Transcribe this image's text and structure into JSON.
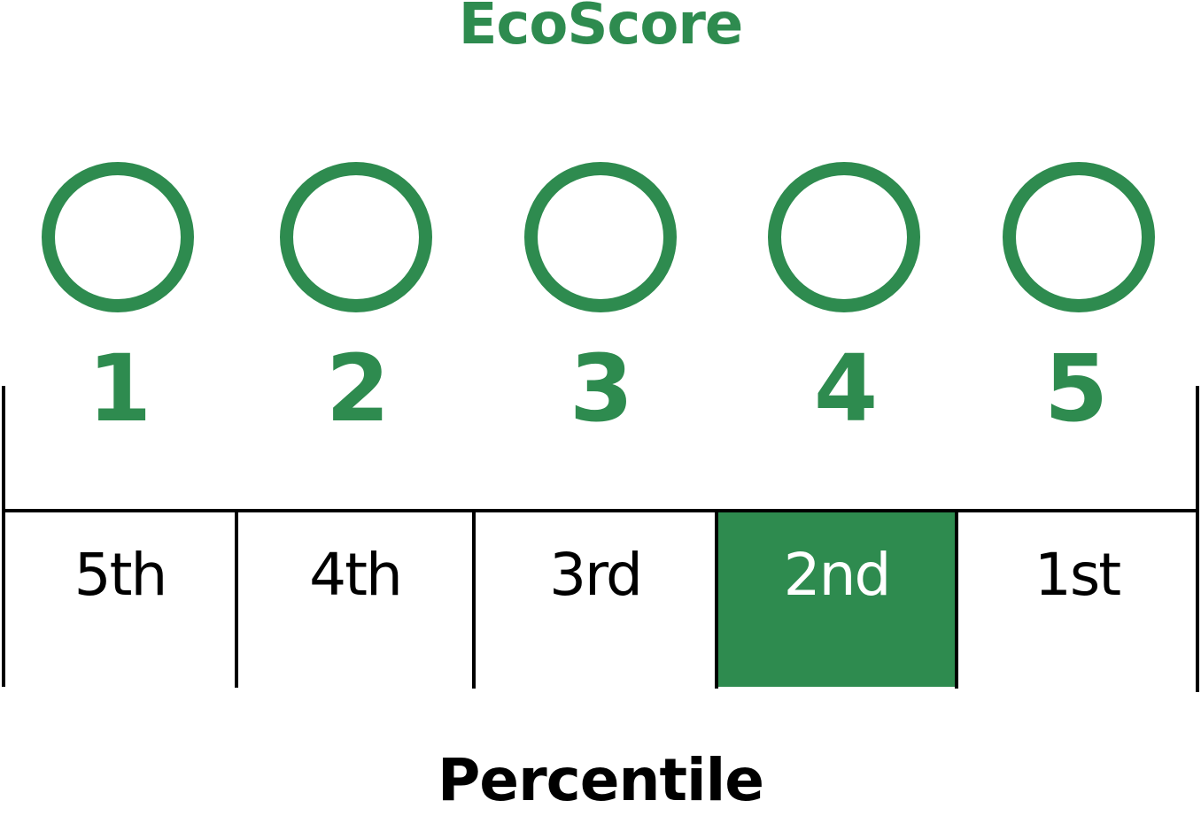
{
  "title": "EcoScore",
  "scores": [
    "1",
    "2",
    "3",
    "4",
    "5"
  ],
  "percentiles": [
    "5th",
    "4th",
    "3rd",
    "2nd",
    "1st"
  ],
  "highlighted_percentile": "2nd",
  "axis_label": "Percentile",
  "colors": {
    "accent": "#2e8b4f",
    "line": "#000000",
    "highlight_text": "#ffffff"
  }
}
